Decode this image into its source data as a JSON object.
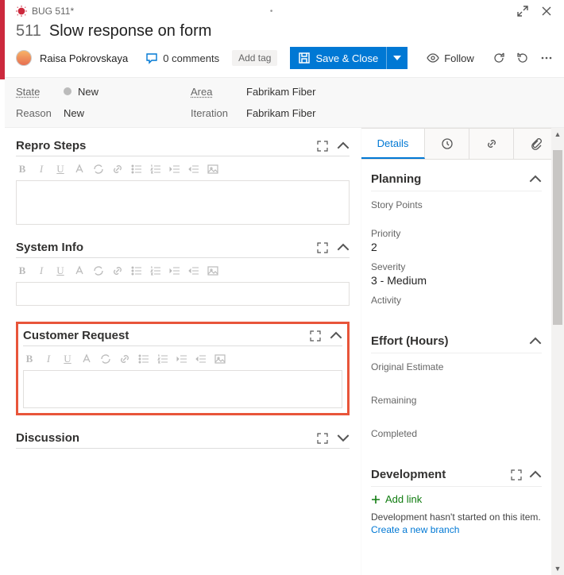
{
  "header": {
    "crumb": "BUG 511*",
    "id": "511",
    "title": "Slow response on form",
    "assignee": "Raisa Pokrovskaya",
    "comments_label": "0 comments",
    "addtag_label": "Add tag",
    "save_label": "Save & Close",
    "follow_label": "Follow"
  },
  "band": {
    "state_label": "State",
    "state_value": "New",
    "reason_label": "Reason",
    "reason_value": "New",
    "area_label": "Area",
    "area_value": "Fabrikam Fiber",
    "iteration_label": "Iteration",
    "iteration_value": "Fabrikam Fiber"
  },
  "left": {
    "repro_title": "Repro Steps",
    "sysinfo_title": "System Info",
    "custreq_title": "Customer Request",
    "discussion_title": "Discussion"
  },
  "right": {
    "tab_details": "Details",
    "planning_title": "Planning",
    "storypoints_label": "Story Points",
    "priority_label": "Priority",
    "priority_value": "2",
    "severity_label": "Severity",
    "severity_value": "3 - Medium",
    "activity_label": "Activity",
    "effort_title": "Effort (Hours)",
    "orig_label": "Original Estimate",
    "remaining_label": "Remaining",
    "completed_label": "Completed",
    "development_title": "Development",
    "addlink_label": "Add link",
    "dev_text": "Development hasn't started on this item.",
    "dev_link": "Create a new branch"
  }
}
